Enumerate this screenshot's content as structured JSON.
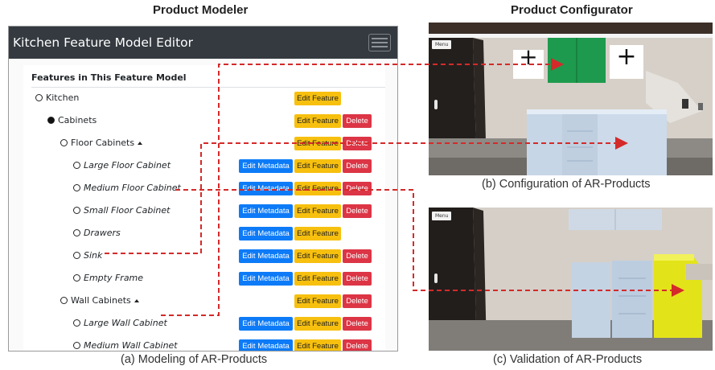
{
  "headings": {
    "modeler": "Product Modeler",
    "configurator": "Product Configurator"
  },
  "editor": {
    "app_title": "Kitchen Feature Model Editor",
    "card_title": "Features in This Feature Model",
    "buttons": {
      "edit_metadata": "Edit Metadata",
      "edit_feature": "Edit Feature",
      "delete": "Delete"
    },
    "features": [
      {
        "label": "Kitchen"
      },
      {
        "label": "Cabinets"
      },
      {
        "label": "Floor Cabinets"
      },
      {
        "label": "Large Floor Cabinet"
      },
      {
        "label": "Medium Floor Cabinet"
      },
      {
        "label": "Small Floor Cabinet"
      },
      {
        "label": "Drawers"
      },
      {
        "label": "Sink"
      },
      {
        "label": "Empty Frame"
      },
      {
        "label": "Wall Cabinets"
      },
      {
        "label": "Large Wall Cabinet"
      },
      {
        "label": "Medium Wall Cabinet"
      }
    ]
  },
  "ar_config": {
    "menu_label": "Menu",
    "plus_symbol": "+"
  },
  "ar_validation": {
    "menu_label": "Menu"
  },
  "captions": {
    "a": "(a) Modeling of AR-Products",
    "b": "(b) Configuration of AR-Products",
    "c": "(c) Validation of AR-Products"
  },
  "colors": {
    "navbar": "#343a40",
    "edit_metadata": "#0d7bf7",
    "edit_feature": "#f7c00f",
    "delete": "#dc3545",
    "connector": "#d42a2a",
    "validation_highlight": "#e3e31a"
  }
}
